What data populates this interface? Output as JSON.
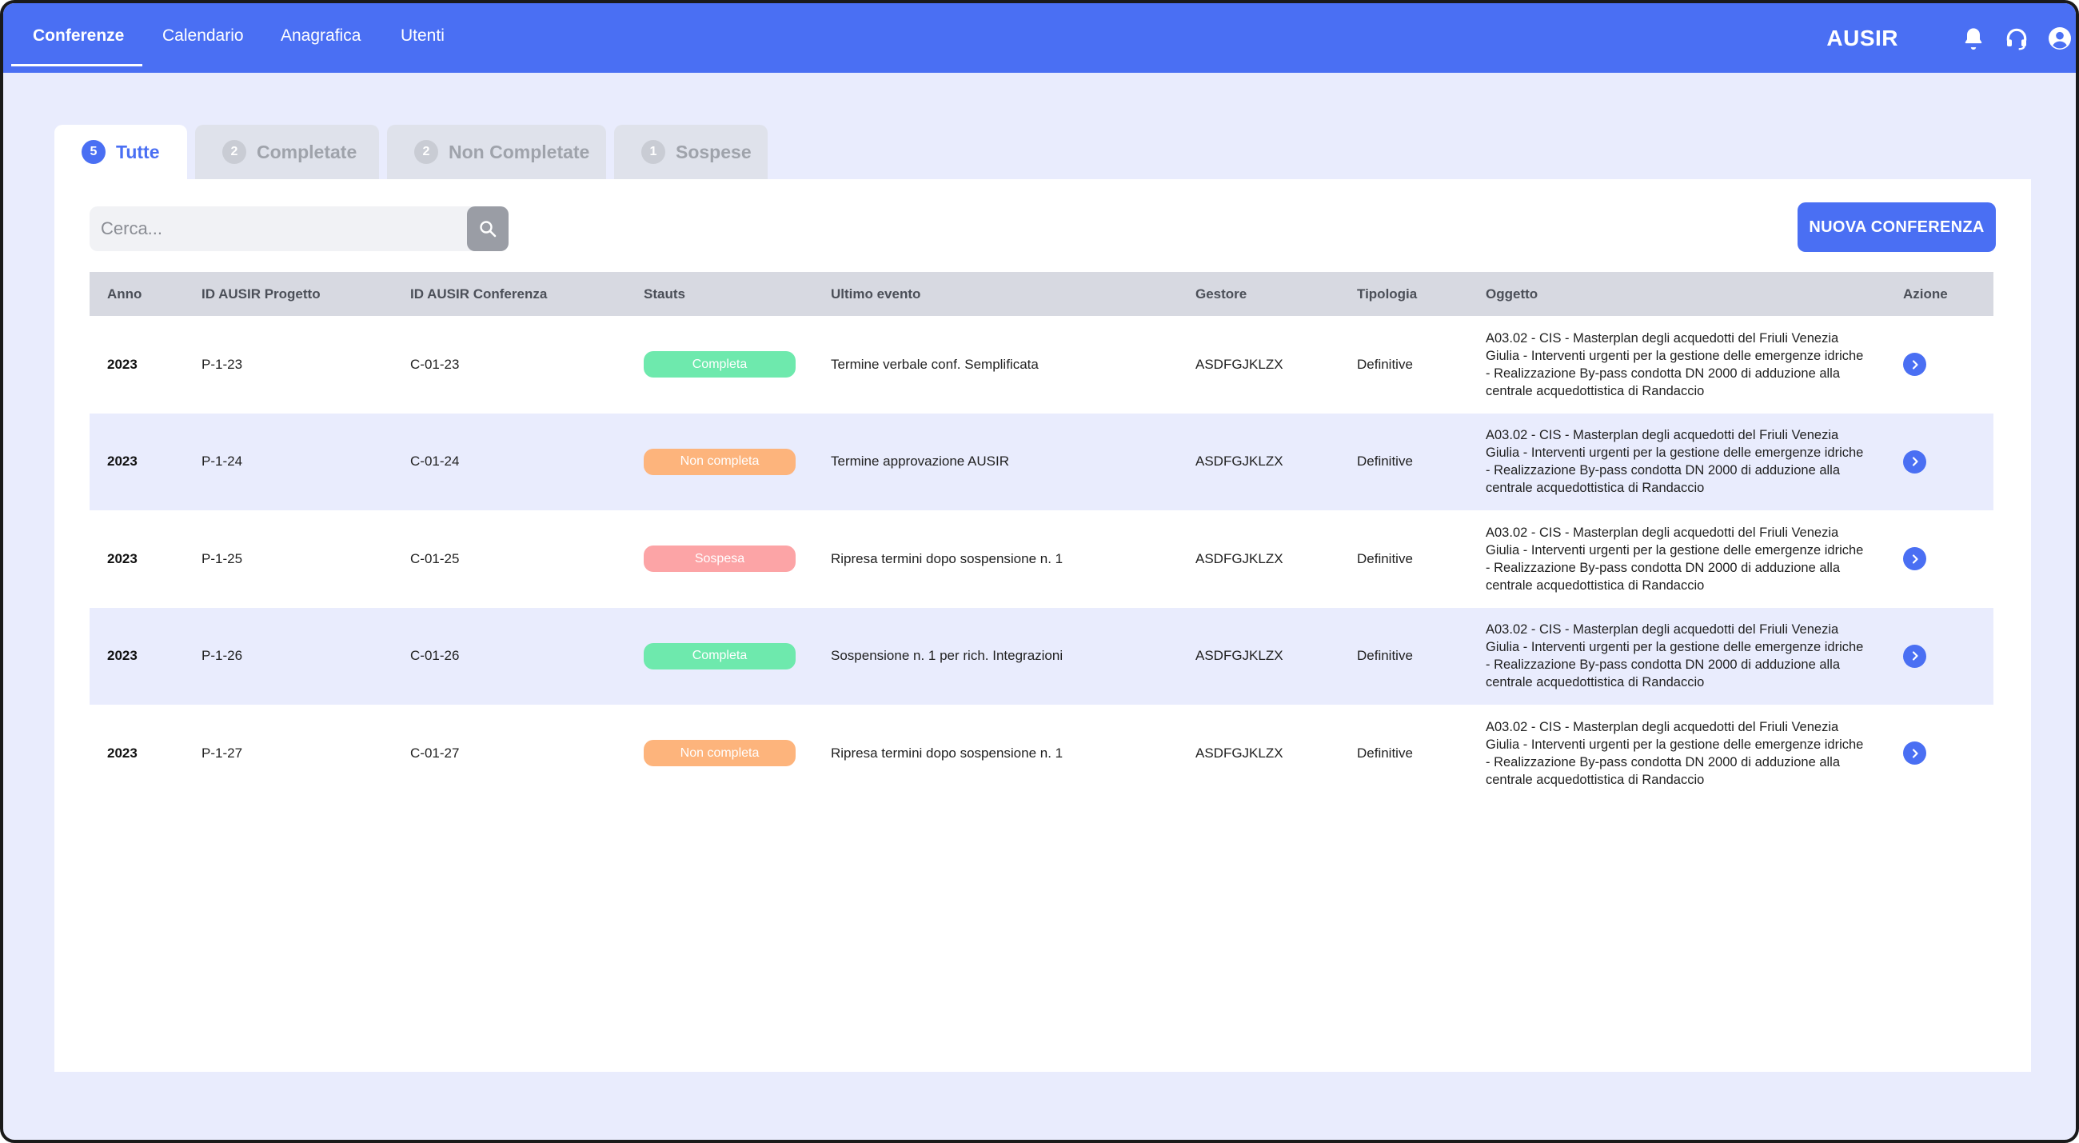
{
  "nav": {
    "tabs": [
      "Conferenze",
      "Calendario",
      "Anagrafica",
      "Utenti"
    ],
    "active": "Conferenze",
    "brand": "AUSIR",
    "icons": [
      "bell-icon",
      "headset-icon",
      "user-circle-icon"
    ]
  },
  "filters": {
    "tabs": [
      {
        "count": "5",
        "label": "Tutte"
      },
      {
        "count": "2",
        "label": "Completate"
      },
      {
        "count": "2",
        "label": "Non Completate"
      },
      {
        "count": "1",
        "label": "Sospese"
      }
    ]
  },
  "search": {
    "placeholder": "Cerca..."
  },
  "toolbar": {
    "new_label": "NUOVA CONFERENZA"
  },
  "colors": {
    "accent": "#4a6ff3",
    "completa": "#6ee9ad",
    "non_completa": "#fdb47c",
    "sospesa": "#fca4a6"
  },
  "table": {
    "headers": [
      "Anno",
      "ID AUSIR Progetto",
      "ID AUSIR Conferenza",
      "Stauts",
      "Ultimo evento",
      "Gestore",
      "Tipologia",
      "Oggetto",
      "Azione"
    ],
    "rows": [
      {
        "anno": "2023",
        "progetto": "P-1-23",
        "conferenza": "C-01-23",
        "status": "Completa",
        "evento": "Termine verbale conf. Semplificata",
        "gestore": "ASDFGJKLZX",
        "tipologia": "Definitive",
        "oggetto": "A03.02 - CIS - Masterplan degli acquedotti del Friuli Venezia Giulia - Interventi urgenti per la gestione delle emergenze idriche - Realizzazione By-pass condotta DN 2000 di adduzione alla centrale acquedottistica di Randaccio"
      },
      {
        "anno": "2023",
        "progetto": "P-1-24",
        "conferenza": "C-01-24",
        "status": "Non completa",
        "evento": "Termine approvazione AUSIR",
        "gestore": "ASDFGJKLZX",
        "tipologia": "Definitive",
        "oggetto": "A03.02 - CIS - Masterplan degli acquedotti del Friuli Venezia Giulia - Interventi urgenti per la gestione delle emergenze idriche - Realizzazione By-pass condotta DN 2000 di adduzione alla centrale acquedottistica di Randaccio"
      },
      {
        "anno": "2023",
        "progetto": "P-1-25",
        "conferenza": "C-01-25",
        "status": "Sospesa",
        "evento": "Ripresa termini dopo sospensione n. 1",
        "gestore": "ASDFGJKLZX",
        "tipologia": "Definitive",
        "oggetto": "A03.02 - CIS - Masterplan degli acquedotti del Friuli Venezia Giulia - Interventi urgenti per la gestione delle emergenze idriche - Realizzazione By-pass condotta DN 2000 di adduzione alla centrale acquedottistica di Randaccio"
      },
      {
        "anno": "2023",
        "progetto": "P-1-26",
        "conferenza": "C-01-26",
        "status": "Completa",
        "evento": "Sospensione n. 1 per rich. Integrazioni",
        "gestore": "ASDFGJKLZX",
        "tipologia": "Definitive",
        "oggetto": "A03.02 - CIS - Masterplan degli acquedotti del Friuli Venezia Giulia - Interventi urgenti per la gestione delle emergenze idriche - Realizzazione By-pass condotta DN 2000 di adduzione alla centrale acquedottistica di Randaccio"
      },
      {
        "anno": "2023",
        "progetto": "P-1-27",
        "conferenza": "C-01-27",
        "status": "Non completa",
        "evento": "Ripresa termini dopo sospensione n. 1",
        "gestore": "ASDFGJKLZX",
        "tipologia": "Definitive",
        "oggetto": "A03.02 - CIS - Masterplan degli acquedotti del Friuli Venezia Giulia - Interventi urgenti per la gestione delle emergenze idriche - Realizzazione By-pass condotta DN 2000 di adduzione alla centrale acquedottistica di Randaccio"
      }
    ]
  }
}
